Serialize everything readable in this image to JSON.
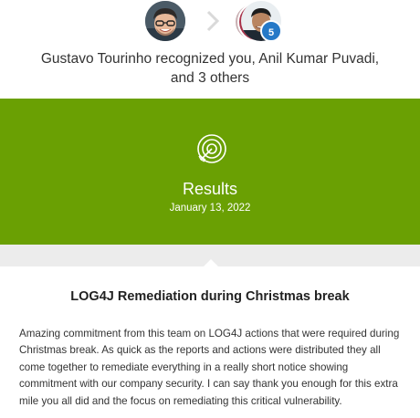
{
  "header": {
    "sender_avatar": "avatar-photo",
    "recipients_count_badge": "5",
    "sender_name": "Gustavo Tourinho",
    "verb": "recognized",
    "recipients_text": "you, Anil Kumar Puvadi,",
    "others_prefix": "and",
    "others_count": "3",
    "others_suffix": "others",
    "arrow_icon": "chevron-right-icon"
  },
  "banner": {
    "icon": "target-arrow-icon",
    "title": "Results",
    "date": "January 13, 2022",
    "color": "#6aa003"
  },
  "card": {
    "title": "LOG4J Remediation during Christmas break",
    "body": "Amazing commitment from this team on LOG4J actions that were required during Christmas break. As quick as the reports and actions were distributed they all come together to remediate everything in a really short notice showing commitment with our company security. I can say thank you enough for this extra mile you all did and the focus on remediating this critical vulnerability."
  },
  "colors": {
    "badge": "#2679c7",
    "strip": "#ececec"
  }
}
